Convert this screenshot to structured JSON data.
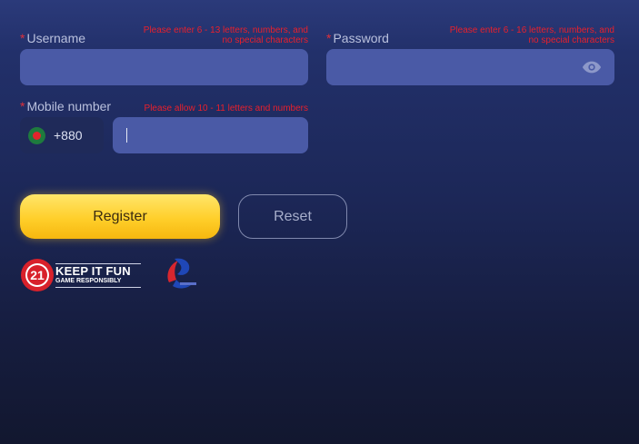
{
  "form": {
    "username": {
      "label": "Username",
      "required_mark": "*",
      "hint_line1": "Please enter 6 - 13 letters, numbers, and",
      "hint_line2": "no special characters",
      "value": ""
    },
    "password": {
      "label": "Password",
      "required_mark": "*",
      "hint_line1": "Please enter 6 - 16 letters, numbers, and",
      "hint_line2": "no special characters",
      "value": ""
    },
    "mobile": {
      "label": "Mobile number",
      "required_mark": "*",
      "hint": "Please allow 10 - 11 letters and numbers",
      "country_code": "+880",
      "value": ""
    },
    "register_label": "Register",
    "reset_label": "Reset"
  },
  "footer": {
    "age_badge_text": "21",
    "keep_it_fun_title": "KEEP IT FUN",
    "keep_it_fun_subtitle": "GAME RESPONSIBLY",
    "regulator_logo": "pagcor-logo"
  },
  "icons": {
    "password_toggle": "eye-icon",
    "flag": "bangladesh-flag-icon"
  },
  "colors": {
    "accent_yellow": "#ffcf2a",
    "error_red": "#e8202c",
    "input_bg": "#4a5aa6"
  }
}
